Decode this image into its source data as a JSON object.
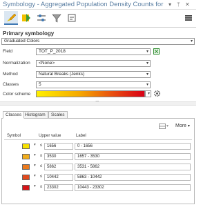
{
  "window": {
    "title": "Symbology - Aggregated Population Density Counts for the N..."
  },
  "primary": {
    "heading": "Primary symbology",
    "method_type": "Graduated Colors"
  },
  "form": {
    "field_label": "Field",
    "field_value": "TOT_P_2018",
    "normalization_label": "Normalization",
    "normalization_value": "<None>",
    "method_label": "Method",
    "method_value": "Natural Breaks (Jenks)",
    "classes_label": "Classes",
    "classes_value": "5",
    "color_scheme_label": "Color scheme"
  },
  "tabs": [
    {
      "label": "Classes"
    },
    {
      "label": "Histogram"
    },
    {
      "label": "Scales"
    }
  ],
  "table": {
    "more_label": "More",
    "headers": {
      "symbol": "Symbol",
      "upper": "Upper value",
      "label": "Label"
    },
    "rows": [
      {
        "le": "≤",
        "upper": "1656",
        "label": "0 - 1656",
        "color": "#f7e200"
      },
      {
        "le": "≤",
        "upper": "3530",
        "label": "1657 - 3530",
        "color": "#f2ad1c"
      },
      {
        "le": "≤",
        "upper": "5862",
        "label": "3531 - 5862",
        "color": "#ec7a1c"
      },
      {
        "le": "≤",
        "upper": "10442",
        "label": "5863 - 10442",
        "color": "#e24a1c"
      },
      {
        "le": "≤",
        "upper": "23302",
        "label": "10443 - 23302",
        "color": "#d71518"
      }
    ]
  },
  "icons": {
    "window_controls": [
      "pin-icon",
      "close-icon"
    ],
    "toolbar": [
      "symbology-brush-icon",
      "vary-symbology-icon",
      "advanced-symbology-icon",
      "mask-icon",
      "label-class-icon"
    ]
  }
}
